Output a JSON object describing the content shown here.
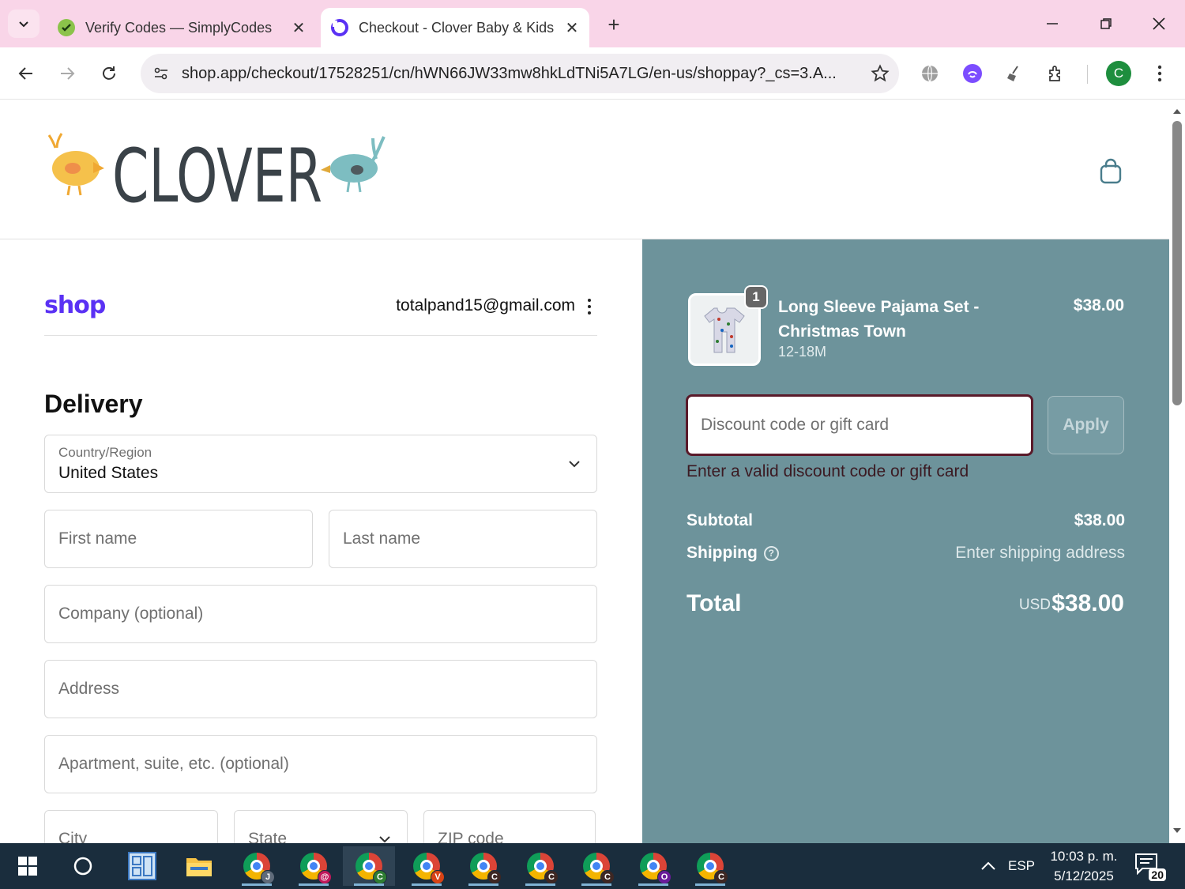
{
  "browser": {
    "tabs": [
      {
        "title": "Verify Codes — SimplyCodes",
        "active": false
      },
      {
        "title": "Checkout - Clover Baby & Kids",
        "active": true
      }
    ],
    "url": "shop.app/checkout/17528251/cn/hWN66JW33mw8hkLdTNi5A7LG/en-us/shoppay?_cs=3.A...",
    "profile_initial": "C"
  },
  "store": {
    "logo_text": "CLOVER"
  },
  "checkout": {
    "shop_brand": "shop",
    "account_email": "totalpand15@gmail.com",
    "delivery_title": "Delivery",
    "country_label": "Country/Region",
    "country_value": "United States",
    "first_name_placeholder": "First name",
    "last_name_placeholder": "Last name",
    "company_placeholder": "Company (optional)",
    "address_placeholder": "Address",
    "apartment_placeholder": "Apartment, suite, etc. (optional)",
    "city_placeholder": "City",
    "state_placeholder": "State",
    "zip_placeholder": "ZIP code"
  },
  "order": {
    "item": {
      "quantity": "1",
      "name": "Long Sleeve Pajama Set - Christmas Town",
      "variant": "12-18M",
      "price": "$38.00"
    },
    "discount_placeholder": "Discount code or gift card",
    "apply_label": "Apply",
    "discount_error": "Enter a valid discount code or gift card",
    "subtotal_label": "Subtotal",
    "subtotal_value": "$38.00",
    "shipping_label": "Shipping",
    "shipping_value": "Enter shipping address",
    "total_label": "Total",
    "total_currency": "USD",
    "total_value": "$38.00"
  },
  "taskbar": {
    "chrome_badges": [
      {
        "letter": "J",
        "color": "#5f6b7a"
      },
      {
        "letter": "@",
        "color": "#c2185b"
      },
      {
        "letter": "C",
        "color": "#2e7d32"
      },
      {
        "letter": "V",
        "color": "#d84315"
      },
      {
        "letter": "C",
        "color": "#3e2723"
      },
      {
        "letter": "C",
        "color": "#3e2723"
      },
      {
        "letter": "C",
        "color": "#3e2723"
      },
      {
        "letter": "O",
        "color": "#6a1b9a"
      },
      {
        "letter": "C",
        "color": "#3e2723"
      }
    ],
    "language": "ESP",
    "time": "10:03 p. m.",
    "date": "5/12/2025",
    "notifications": "20"
  },
  "colors": {
    "summary_bg": "#6d939b",
    "shop_purple": "#5a31f4",
    "tab_strip": "#f9d5e8",
    "discount_border": "#5a1a2a"
  }
}
